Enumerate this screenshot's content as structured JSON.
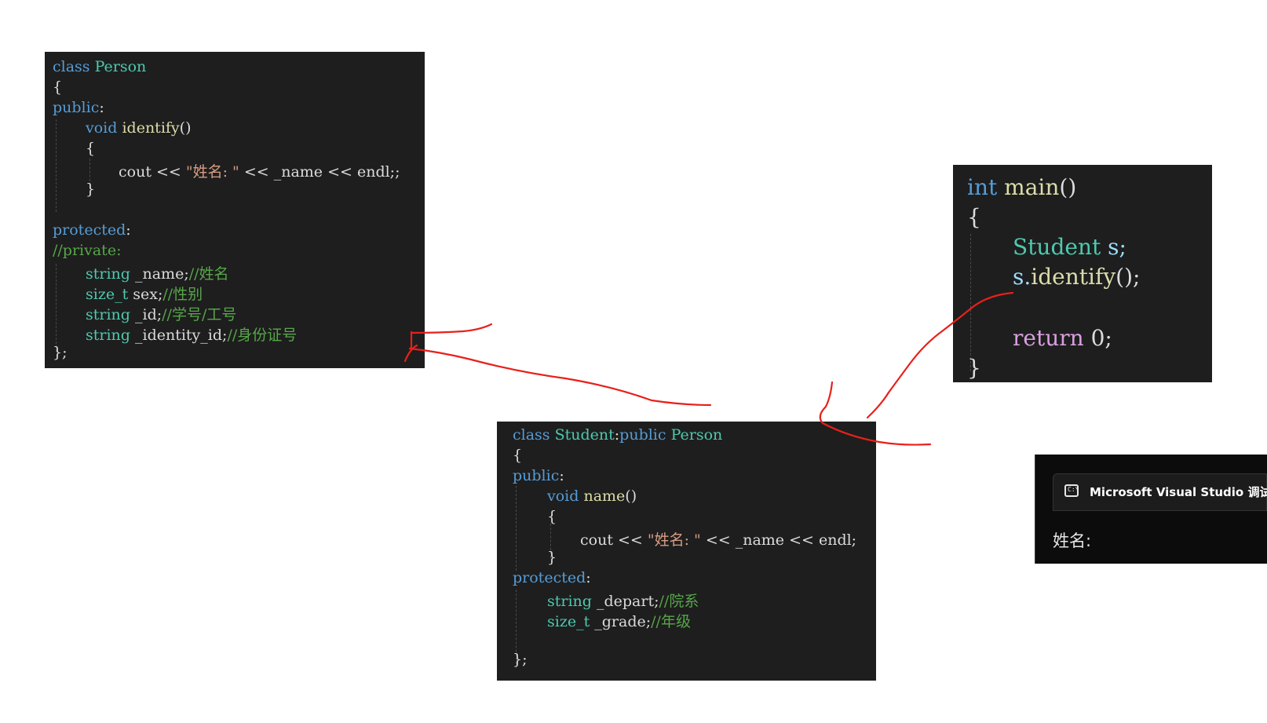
{
  "person_panel": {
    "l1_kw": "class",
    "l1_name": " Person",
    "l2": "{",
    "l3_kw": "public",
    "l3_colon": ":",
    "l4_kw": "void",
    "l4_fn": " identify",
    "l4_paren": "()",
    "l5": "{",
    "l6_pre": "cout << ",
    "l6_str": "\"姓名: \"",
    "l6_post": " << _name << endl;;",
    "l7": "}",
    "l9_kw": "protected",
    "l9_colon": ":",
    "l10": "//private:",
    "l11_type": "string",
    "l11_mem": " _name;",
    "l11_cmt": "//姓名",
    "l12_type": "size_t",
    "l12_mem": " sex;",
    "l12_cmt": "//性别",
    "l13_type": "string",
    "l13_mem": " _id;",
    "l13_cmt": "//学号/工号",
    "l14_type": "string",
    "l14_mem": " _identity_id;",
    "l14_cmt": "//身份证号",
    "l15": "};"
  },
  "main_panel": {
    "l1_kw": "int",
    "l1_fn": " main",
    "l1_paren": "()",
    "l2": "{",
    "l3_type": "Student",
    "l3_var": " s;",
    "l4_var": "s.",
    "l4_fn": "identify",
    "l4_rest": "();",
    "l6_kw": "return",
    "l6_rest": " 0;",
    "l7": "}"
  },
  "student_panel": {
    "l1_kw": "class",
    "l1_name": " Student",
    "l1_colon": ":",
    "l1_kw2": "public",
    "l1_base": " Person",
    "l2": "{",
    "l3_kw": "public",
    "l3_colon": ":",
    "l4_kw": "void",
    "l4_fn": " name",
    "l4_paren": "()",
    "l5": "{",
    "l6_pre": "cout << ",
    "l6_str": "\"姓名: \"",
    "l6_post": " << _name << endl;",
    "l7": "}",
    "l8_kw": "protected",
    "l8_colon": ":",
    "l9_type": "string",
    "l9_mem": " _depart;",
    "l9_cmt": "//院系",
    "l10_type": "size_t",
    "l10_mem": " _grade;",
    "l10_cmt": "//年级",
    "l12": "};"
  },
  "console": {
    "title": "Microsoft Visual Studio 调试控",
    "icon_text": "C:\\",
    "output": "姓名:"
  },
  "colors": {
    "editor_bg": "#1e1e1e",
    "keyword": "#569cd6",
    "type": "#4ec9b0",
    "function": "#dcdcaa",
    "string": "#d69d85",
    "comment": "#57a64a",
    "annotation_ink": "#e8201a"
  }
}
